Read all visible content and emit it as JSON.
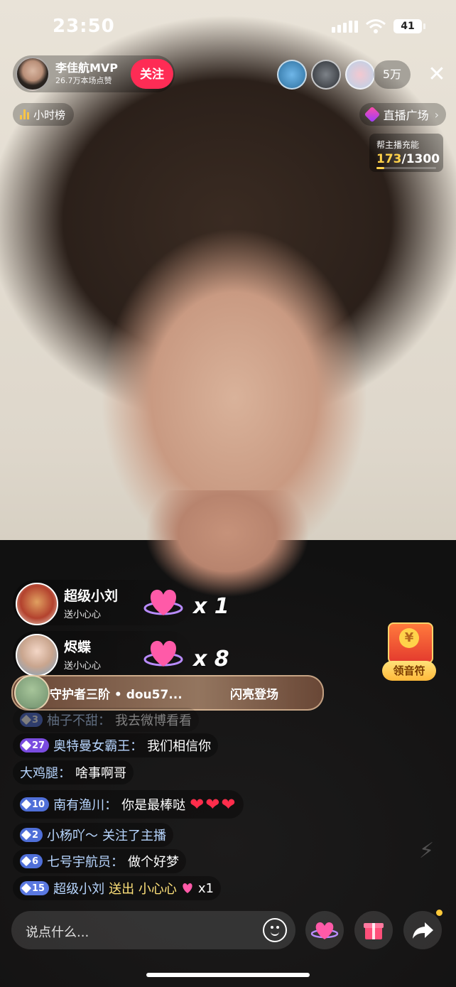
{
  "status_bar": {
    "time": "23:50",
    "battery": "41"
  },
  "host": {
    "name": "李佳航MVP",
    "likes": "26.7万本场点赞",
    "follow_label": "关注"
  },
  "viewers": {
    "count": "5万",
    "close": "✕"
  },
  "rank_label": "小时榜",
  "plaza_label": "直播广场",
  "charge": {
    "title": "帮主播充能",
    "current": "173",
    "total": "/1300",
    "progress": 0.133
  },
  "gift_combos": [
    {
      "user": "超级小刘",
      "action": "送小心心",
      "count": "x 1"
    },
    {
      "user": "烬蝶",
      "action": "送小心心",
      "count": "x 8"
    }
  ],
  "guard_banner": {
    "text": "守护者三阶 • dou57...",
    "action": "闪亮登场"
  },
  "chat": [
    {
      "level": "3",
      "user": "柚子不甜：",
      "message": "我去微博看看"
    },
    {
      "level": "27",
      "user": "奥特曼女霸王：",
      "message": "我们相信你"
    },
    {
      "level": "",
      "user": "大鸡腿：",
      "message": "啥事啊哥"
    },
    {
      "level": "10",
      "user": "南有渔川：",
      "message": "你是最棒哒",
      "hearts": "❤❤❤"
    },
    {
      "level": "2",
      "user": "小杨吖～",
      "message": "关注了主播"
    },
    {
      "level": "6",
      "user": "七号宇航员：",
      "message": "做个好梦"
    },
    {
      "level": "15",
      "user": "超级小刘",
      "message": "送出 小心心",
      "suffix": "x1"
    }
  ],
  "side": {
    "yin_label": "领音符",
    "coin": "¥"
  },
  "input": {
    "placeholder": "说点什么..."
  },
  "colors": {
    "follow": "#fe2c55",
    "accent_gold": "#ffd24a",
    "level_blue": "#4f6fd8",
    "level_purple": "#7a4ce0"
  },
  "icons": [
    "signal-icon",
    "wifi-icon",
    "battery-icon",
    "close-icon",
    "bar-chart-icon",
    "gem-icon",
    "heart-gift-icon",
    "emoji-icon",
    "gift-box-icon",
    "share-icon",
    "flash-icon"
  ]
}
